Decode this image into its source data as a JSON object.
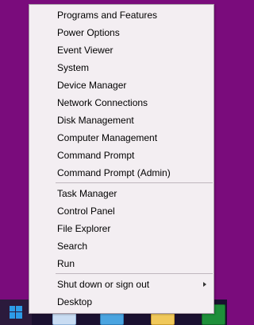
{
  "context_menu": {
    "items": [
      {
        "label": "Programs and Features"
      },
      {
        "label": "Power Options"
      },
      {
        "label": "Event Viewer"
      },
      {
        "label": "System"
      },
      {
        "label": "Device Manager"
      },
      {
        "label": "Network Connections"
      },
      {
        "label": "Disk Management"
      },
      {
        "label": "Computer Management"
      },
      {
        "label": "Command Prompt"
      },
      {
        "label": "Command Prompt (Admin)"
      },
      {
        "label": "Task Manager"
      },
      {
        "label": "Control Panel"
      },
      {
        "label": "File Explorer"
      },
      {
        "label": "Search"
      },
      {
        "label": "Run"
      },
      {
        "label": "Shut down or sign out",
        "has_submenu": true
      },
      {
        "label": "Desktop"
      }
    ]
  },
  "taskbar": {
    "icons": [
      "windows-logo-icon",
      "file-explorer-icon",
      "internet-explorer-icon",
      "folder-icon",
      "store-icon"
    ]
  },
  "colors": {
    "desktop_background": "#7a0c7c",
    "menu_background": "#f3eef2",
    "taskbar_background": "#1a1030"
  }
}
